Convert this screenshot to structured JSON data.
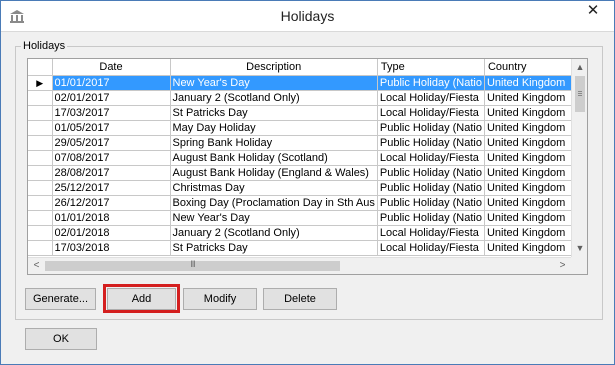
{
  "window": {
    "title": "Holidays",
    "close_glyph": "✕",
    "app_icon": "bank-icon"
  },
  "group": {
    "label": "Holidays"
  },
  "table": {
    "columns": [
      "Date",
      "Description",
      "Type",
      "Country"
    ],
    "rows": [
      {
        "date": "01/01/2017",
        "description": "New Year's Day",
        "type": "Public Holiday (Natio",
        "country": "United Kingdom",
        "selected": true
      },
      {
        "date": "02/01/2017",
        "description": "January 2 (Scotland Only)",
        "type": "Local Holiday/Fiesta",
        "country": "United Kingdom"
      },
      {
        "date": "17/03/2017",
        "description": "St Patricks Day",
        "type": "Local Holiday/Fiesta",
        "country": "United Kingdom"
      },
      {
        "date": "01/05/2017",
        "description": "May Day Holiday",
        "type": "Public Holiday (Natio",
        "country": "United Kingdom"
      },
      {
        "date": "29/05/2017",
        "description": "Spring Bank Holiday",
        "type": "Public Holiday (Natio",
        "country": "United Kingdom"
      },
      {
        "date": "07/08/2017",
        "description": "August Bank Holiday (Scotland)",
        "type": "Local Holiday/Fiesta",
        "country": "United Kingdom"
      },
      {
        "date": "28/08/2017",
        "description": "August Bank Holiday (England & Wales)",
        "type": "Public Holiday (Natio",
        "country": "United Kingdom"
      },
      {
        "date": "25/12/2017",
        "description": "Christmas Day",
        "type": "Public Holiday (Natio",
        "country": "United Kingdom"
      },
      {
        "date": "26/12/2017",
        "description": "Boxing Day (Proclamation Day in Sth Aus",
        "type": "Public Holiday (Natio",
        "country": "United Kingdom"
      },
      {
        "date": "01/01/2018",
        "description": "New Year's Day",
        "type": "Public Holiday (Natio",
        "country": "United Kingdom"
      },
      {
        "date": "02/01/2018",
        "description": "January 2 (Scotland Only)",
        "type": "Local Holiday/Fiesta",
        "country": "United Kingdom"
      },
      {
        "date": "17/03/2018",
        "description": "St Patricks Day",
        "type": "Local Holiday/Fiesta",
        "country": "United Kingdom"
      }
    ],
    "current_row_marker": "▶"
  },
  "buttons": {
    "generate": "Generate...",
    "add": "Add",
    "modify": "Modify",
    "delete": "Delete",
    "ok": "OK"
  },
  "scroll": {
    "up": "▲",
    "down": "▼",
    "left": "<",
    "right": ">",
    "grip": "III"
  },
  "colors": {
    "selection": "#3399ff",
    "highlight": "#d41f1f"
  }
}
